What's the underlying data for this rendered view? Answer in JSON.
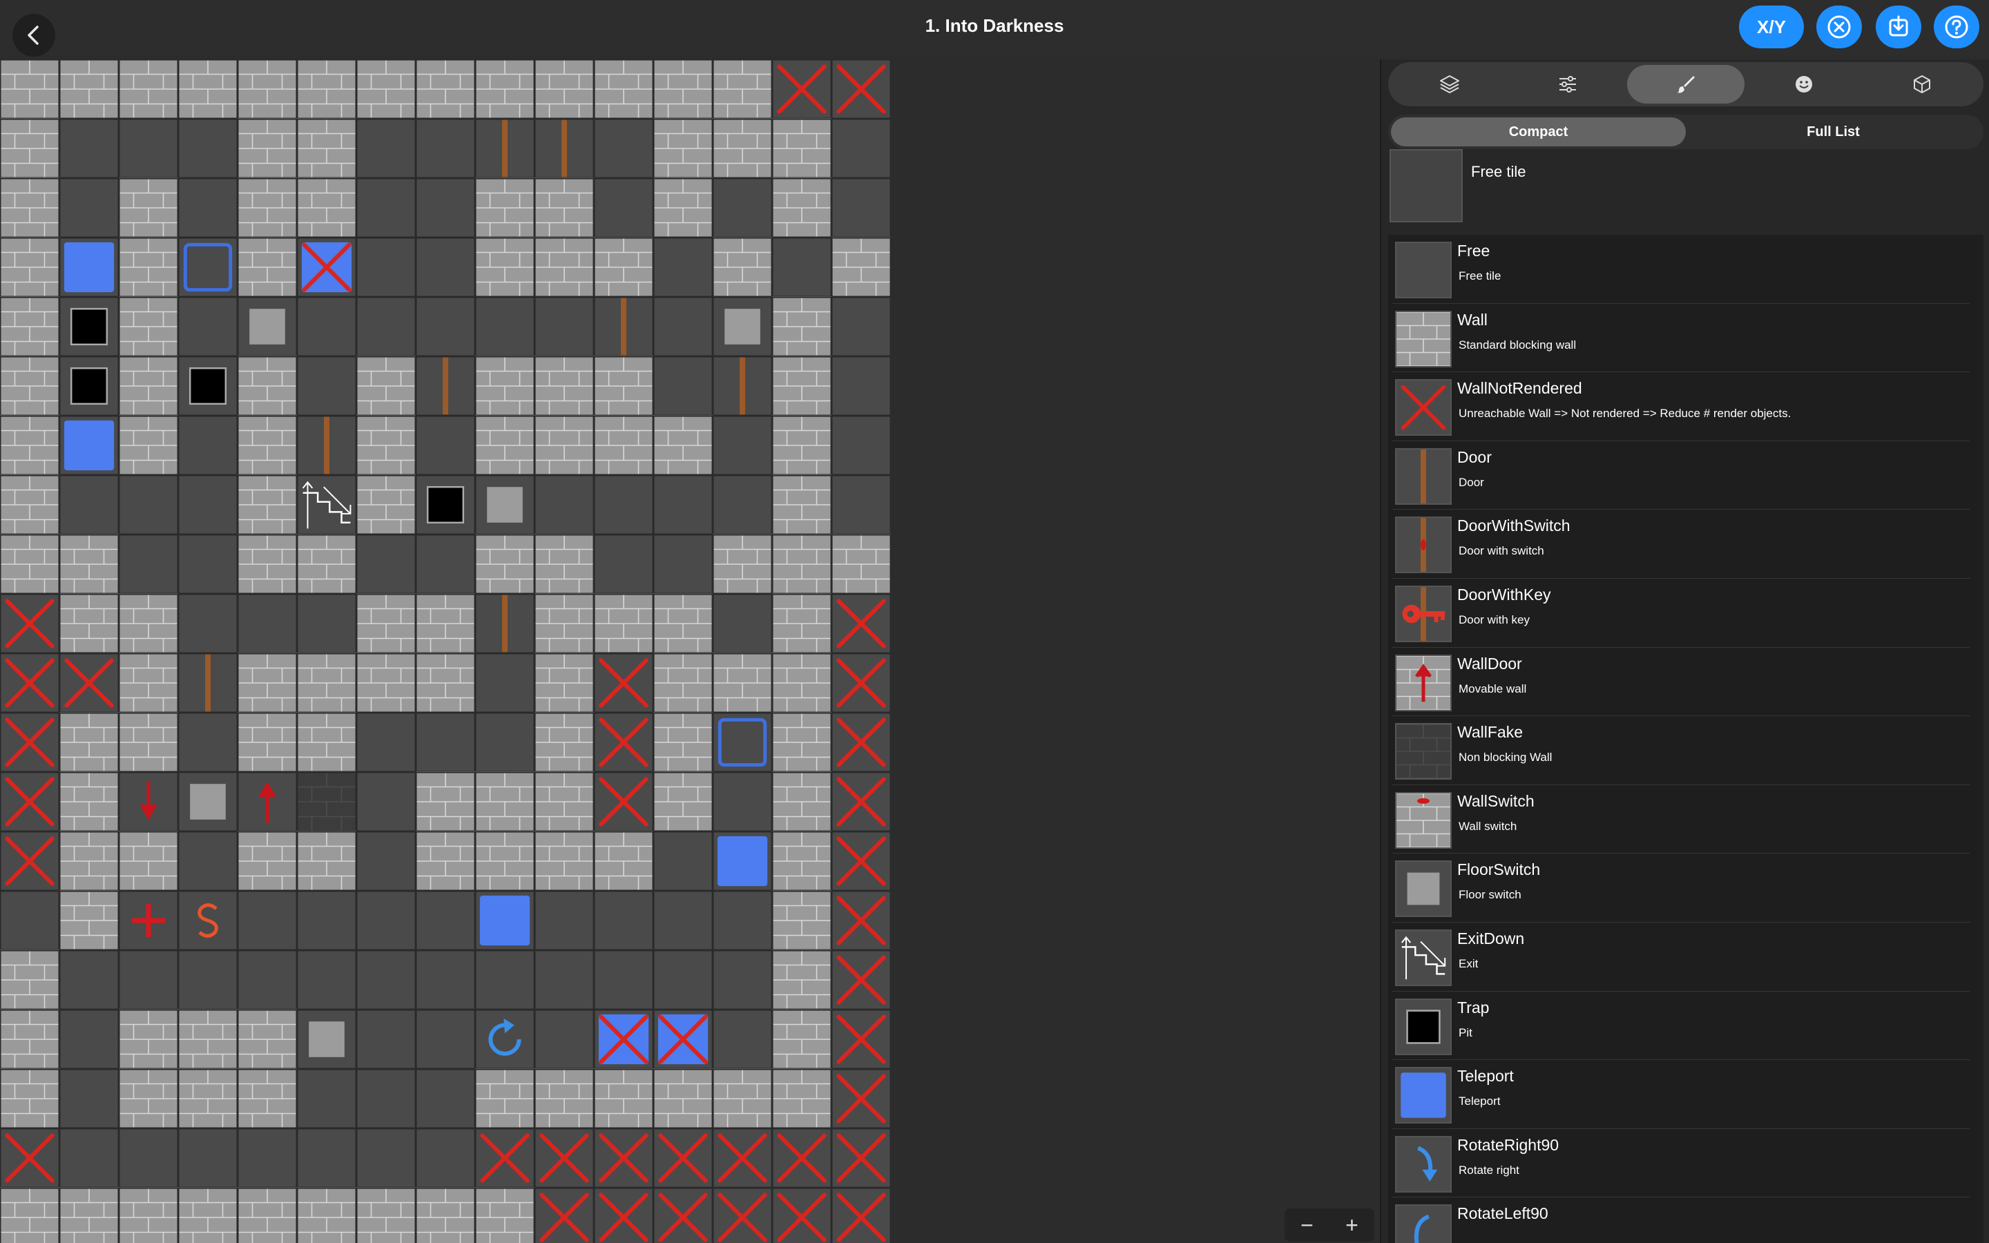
{
  "header": {
    "title": "1. Into Darkness",
    "xy_label": "X/Y"
  },
  "zoom": {
    "minus": "−",
    "plus": "+"
  },
  "panel": {
    "tabs": [
      "layers-icon",
      "sliders-icon",
      "brush-icon",
      "smiley-icon",
      "cube-icon"
    ],
    "active_tab": 2,
    "segments": {
      "compact": "Compact",
      "full": "Full List"
    },
    "selected": {
      "label": "Free tile"
    },
    "items": [
      {
        "name": "Free",
        "desc": "Free tile",
        "icon": "free"
      },
      {
        "name": "Wall",
        "desc": "Standard blocking wall",
        "icon": "wall"
      },
      {
        "name": "WallNotRendered",
        "desc": "Unreachable Wall => Not rendered => Reduce # render objects.",
        "icon": "xwall"
      },
      {
        "name": "Door",
        "desc": "Door",
        "icon": "door"
      },
      {
        "name": "DoorWithSwitch",
        "desc": "Door with switch",
        "icon": "doorswitch"
      },
      {
        "name": "DoorWithKey",
        "desc": "Door with key",
        "icon": "doorkey"
      },
      {
        "name": "WallDoor",
        "desc": "Movable wall",
        "icon": "walldoor"
      },
      {
        "name": "WallFake",
        "desc": "Non blocking Wall",
        "icon": "wallfake"
      },
      {
        "name": "WallSwitch",
        "desc": "Wall switch",
        "icon": "wallswitch"
      },
      {
        "name": "FloorSwitch",
        "desc": "Floor switch",
        "icon": "floorswitch"
      },
      {
        "name": "ExitDown",
        "desc": "Exit",
        "icon": "exit"
      },
      {
        "name": "Trap",
        "desc": "Pit",
        "icon": "trap"
      },
      {
        "name": "Teleport",
        "desc": "Teleport",
        "icon": "teleport"
      },
      {
        "name": "RotateRight90",
        "desc": "Rotate right",
        "icon": "rotright"
      },
      {
        "name": "RotateLeft90",
        "desc": "",
        "icon": "rotleft"
      }
    ]
  },
  "map": {
    "legend": "W=wall F=free X=wall-not-rendered T=teleport P=pit S=floor-switch D=door E=exit U=wall-door-up V=wall-door-down R=rotate G=fake-wall K=teleport-outline H=heal L=letter-S Y=teleport-crossed Z=free-crossed",
    "rows": [
      "WWWWWWWWWWWWWXX",
      "WFFFWWFFDDFWWW",
      "WFWFWWFFWWFWFW",
      "WTWKWYFFWWWFWFW",
      "WPWFSFFFFFDFSW",
      "WPWPWFWDWWWFDW",
      "WTWFWDWFWWWWFW",
      "WFFFWEWPSFFFFW",
      "WWFFWWFFWWFFWWW",
      "XWWFFFWWDWWWFWX",
      "XXWDWWWWFWXWWWX",
      "XWWFWWFFFWXWKWX",
      "XWVSUGFWWWXWFWX",
      "XWWFWWFWWWWFTWX",
      "FWHLFFFFTFFFFWX",
      "WFFFFFFFFFFFFWX",
      "WFWWWSFFRFYYFWX",
      "WFWWWFFFWWWWWWX",
      "XFFFFFFFZXXXXXX",
      "WWWWWWWWWXXXXXX"
    ]
  }
}
